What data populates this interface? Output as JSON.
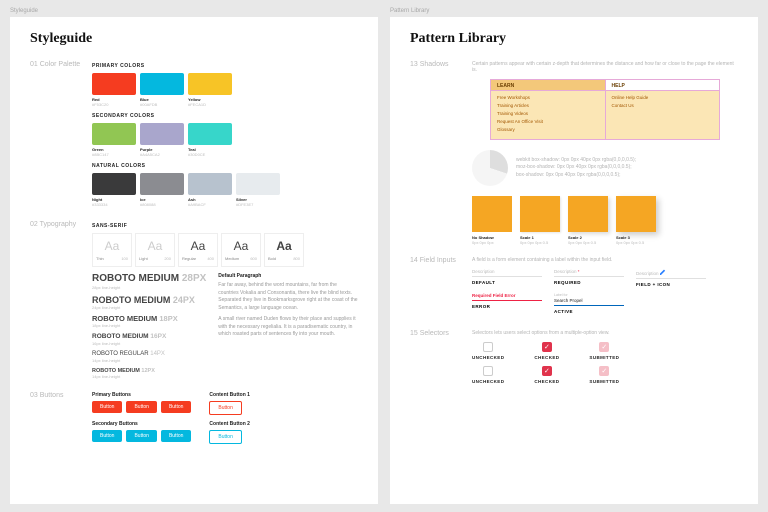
{
  "left": {
    "paneLabel": "Styleguide",
    "title": "Styleguide",
    "sections": {
      "palette": {
        "num": "01 Color Palette",
        "groups": [
          {
            "label": "PRIMARY COLORS",
            "swatches": [
              {
                "name": "Red",
                "hex": "#F53C20",
                "color": "#F53C20"
              },
              {
                "name": "Blue",
                "hex": "#00AFDB",
                "color": "#04B8DF"
              },
              {
                "name": "Yellow",
                "hex": "#FECA1D",
                "color": "#F7C426"
              }
            ]
          },
          {
            "label": "SECONDARY COLORS",
            "swatches": [
              {
                "name": "Green",
                "hex": "#8BC147",
                "color": "#91C653"
              },
              {
                "name": "Purple",
                "hex": "#A4A5CA2",
                "color": "#A9A6CC"
              },
              {
                "name": "Teal",
                "hex": "#30D0CE",
                "color": "#37D6CA"
              }
            ]
          },
          {
            "label": "NATURAL COLORS",
            "swatches": [
              {
                "name": "Night",
                "hex": "#333334",
                "color": "#3A3A3B"
              },
              {
                "name": "Ice",
                "hex": "#808088",
                "color": "#8B8C91"
              },
              {
                "name": "Ash",
                "hex": "#A9BACF",
                "color": "#B7C2CE"
              },
              {
                "name": "Silver",
                "hex": "#DFE3E7",
                "color": "#E7EBEE"
              }
            ]
          }
        ]
      },
      "typography": {
        "num": "02 Typography",
        "label": "SANS-SERIF",
        "weights": [
          {
            "style": "light",
            "name": "Thin",
            "num": "100"
          },
          {
            "style": "light",
            "name": "Light",
            "num": "200"
          },
          {
            "style": "reg",
            "name": "Regular",
            "num": "400"
          },
          {
            "style": "med",
            "name": "Medium",
            "num": "600"
          },
          {
            "style": "bold",
            "name": "Bold",
            "num": "800"
          }
        ],
        "scale": [
          {
            "name": "ROBOTO MEDIUM",
            "px": "28PX",
            "sub": "28px line-height",
            "size": "10px",
            "weight": "600"
          },
          {
            "name": "ROBOTO MEDIUM",
            "px": "24PX",
            "sub": "24px line-height",
            "size": "9px",
            "weight": "600"
          },
          {
            "name": "ROBOTO MEDIUM",
            "px": "18PX",
            "sub": "18px line-height",
            "size": "7.5px",
            "weight": "600"
          },
          {
            "name": "ROBOTO MEDIUM",
            "px": "16PX",
            "sub": "16px line-height",
            "size": "6.5px",
            "weight": "600"
          },
          {
            "name": "ROBOTO REGULAR",
            "px": "14PX",
            "sub": "14px line-height",
            "size": "6px",
            "weight": "400"
          },
          {
            "name": "ROBOTO MEDIUM",
            "px": "12PX",
            "sub": "14px line-height",
            "size": "5.5px",
            "weight": "600"
          }
        ],
        "paraTitle": "Default Paragraph",
        "para1": "Far far away, behind the word mountains, far from the countries Vokalia and Consonantia, there live the blind texts. Separated they live in Bookmarksgrove right at the coast of the Semantics, a large language ocean.",
        "para2": "A small river named Duden flows by their place and supplies it with the necessary regelialia. It is a paradisematic country, in which roasted parts of sentences fly into your mouth."
      },
      "buttons": {
        "num": "03 Buttons",
        "groups": [
          {
            "label": "Primary Buttons",
            "bg": "#F53C20",
            "items": [
              "Button",
              "Button",
              "Button"
            ]
          },
          {
            "label": "Content Button 1",
            "outline": "#F53C20",
            "items": [
              "Button"
            ]
          },
          {
            "label": "Secondary Buttons",
            "bg": "#04B8DF",
            "items": [
              "Button",
              "Button",
              "Button"
            ]
          },
          {
            "label": "Content Button 2",
            "outline": "#04B8DF",
            "items": [
              "Button"
            ]
          }
        ]
      }
    }
  },
  "right": {
    "paneLabel": "Pattern Library",
    "title": "Pattern Library",
    "shadows": {
      "num": "13 Shadows",
      "desc": "Certain patterns appear with certain z-depth that determines the distance and how far or close to the page the element is.",
      "menu": {
        "tabs": [
          "LEARN",
          "HELP"
        ],
        "col1": [
          "Free Workshops",
          "Training Articles",
          "Training Videos",
          "Request An Office Visit",
          "Glossary"
        ],
        "col2": [
          "Online Help Guide",
          "Contact Us"
        ]
      },
      "box_text": [
        "webkit box-shadow: 0px 0px 40px 0px rgba(0,0,0,0.5);",
        "moz-box-shadow: 0px 0px 40px 0px rgba(0,0,0,0.5);",
        "box-shadow: 0px 0px 40px 0px rgba(0,0,0,0.5);"
      ],
      "cards": [
        {
          "label": "No Shadow",
          "sub": "0px 0px 0px"
        },
        {
          "label": "Scale 1",
          "sub": "0px 0px 0px 0.5"
        },
        {
          "label": "Scale 2",
          "sub": "0px 0px 0px 0.5"
        },
        {
          "label": "Scale 3",
          "sub": "0px 0px 0px 0.5"
        }
      ]
    },
    "fields": {
      "num": "14 Field Inputs",
      "desc": "A field is a form element containing a label within the input field.",
      "items": [
        {
          "label": "Description",
          "state": "DEFAULT"
        },
        {
          "label": "Description",
          "state": "REQUIRED",
          "req": true
        },
        {
          "label": "Description",
          "state": "FIELD + ICON",
          "icon": true
        },
        {
          "label": "Required Field Error",
          "state": "ERROR",
          "err": true
        },
        {
          "label": "Search Propel",
          "state": "ACTIVE",
          "underlabel": "Label for",
          "act": true
        }
      ]
    },
    "selectors": {
      "num": "15 Selectors",
      "desc": "Selectors lets users select options from a multiple-option view.",
      "checkbox": [
        {
          "label": "UNCHECKED"
        },
        {
          "label": "CHECKED",
          "checked": true
        },
        {
          "label": "SUBMITTED",
          "sub": true
        }
      ],
      "radio": [
        {
          "label": "UNCHECKED"
        },
        {
          "label": "CHECKED",
          "checked": true
        },
        {
          "label": "SUBMITTED",
          "sub": true
        }
      ]
    }
  }
}
